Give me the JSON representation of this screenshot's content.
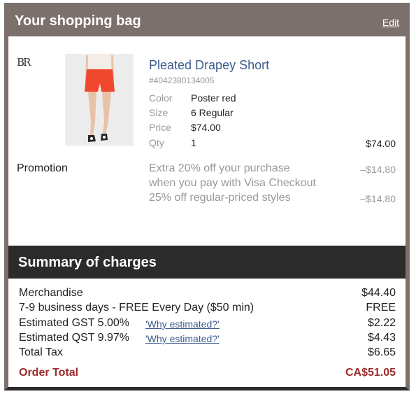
{
  "header": {
    "title": "Your shopping bag",
    "edit_label": "Edit"
  },
  "brand_logo": "BR",
  "product": {
    "name": "Pleated Drapey Short",
    "sku": "#4042380134005",
    "attributes": [
      {
        "label": "Color",
        "value": "Poster red"
      },
      {
        "label": "Size",
        "value": "6 Regular"
      },
      {
        "label": "Price",
        "value": "$74.00"
      },
      {
        "label": "Qty",
        "value": "1"
      }
    ],
    "line_total": "$74.00"
  },
  "promotion": {
    "label": "Promotion",
    "lines": [
      "Extra 20% off your purchase",
      "when you pay with Visa Checkout",
      "25% off regular-priced styles"
    ],
    "amounts": [
      "–$14.80",
      "–$14.80"
    ]
  },
  "summary": {
    "title": "Summary of charges",
    "rows": [
      {
        "label": "Merchandise",
        "value": "$44.40"
      },
      {
        "label": "7-9 business days - FREE Every Day ($50 min)",
        "value": "FREE"
      },
      {
        "label": "Estimated GST 5.00%",
        "link": "'Why estimated?'",
        "value": "$2.22"
      },
      {
        "label": "Estimated QST 9.97%",
        "link": "'Why estimated?'",
        "value": "$4.43"
      },
      {
        "label": "Total Tax",
        "value": "$6.65"
      }
    ],
    "order_total_label": "Order Total",
    "order_total_value": "CA$51.05"
  },
  "colors": {
    "header_bg": "#7b706b",
    "summary_bg": "#2b2b2b",
    "link": "#3d5d8e",
    "order_total": "#9b2b2b",
    "product_red": "#f0482c"
  }
}
